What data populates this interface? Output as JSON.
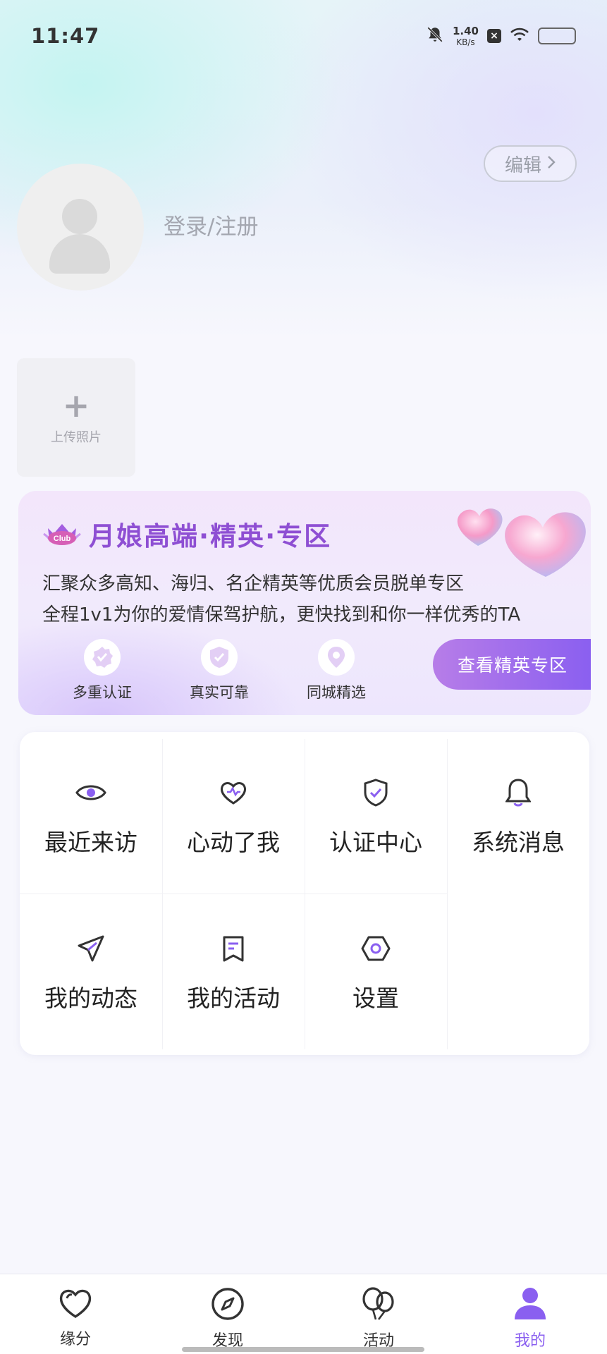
{
  "status_bar": {
    "time": "11:47",
    "speed_value": "1.40",
    "speed_unit": "KB/s"
  },
  "profile": {
    "edit_label": "编辑",
    "login_label": "登录/注册",
    "upload_label": "上传照片"
  },
  "elite": {
    "title_prefix": "月娘高端",
    "title_mid": "精英",
    "title_suffix": "专区",
    "badge_text": "Club",
    "desc_line1": "汇聚众多高知、海归、名企精英等优质会员脱单专区",
    "desc_line2": "全程1v1为你的爱情保驾护航，更快找到和你一样优秀的TA",
    "features": [
      {
        "label": "多重认证",
        "icon": "verified-badge-icon"
      },
      {
        "label": "真实可靠",
        "icon": "shield-check-icon"
      },
      {
        "label": "同城精选",
        "icon": "location-pin-icon"
      }
    ],
    "button_label": "查看精英专区"
  },
  "menu": {
    "row1": [
      {
        "label": "最近来访",
        "icon": "eye-icon"
      },
      {
        "label": "心动了我",
        "icon": "heart-pulse-icon"
      },
      {
        "label": "认证中心",
        "icon": "shield-check-icon"
      },
      {
        "label": "系统消息",
        "icon": "bell-icon"
      }
    ],
    "row2": [
      {
        "label": "我的动态",
        "icon": "paper-plane-icon"
      },
      {
        "label": "我的活动",
        "icon": "bookmark-list-icon"
      },
      {
        "label": "设置",
        "icon": "hexagon-settings-icon"
      }
    ]
  },
  "nav": {
    "items": [
      {
        "label": "缘分",
        "icon": "heart-icon"
      },
      {
        "label": "发现",
        "icon": "compass-icon"
      },
      {
        "label": "活动",
        "icon": "balloons-icon"
      },
      {
        "label": "我的",
        "icon": "person-icon"
      }
    ],
    "active_index": 3
  },
  "colors": {
    "accent": "#8a5ff0",
    "elite_title": "#8e4fd3",
    "background": "#f7f7fd"
  }
}
